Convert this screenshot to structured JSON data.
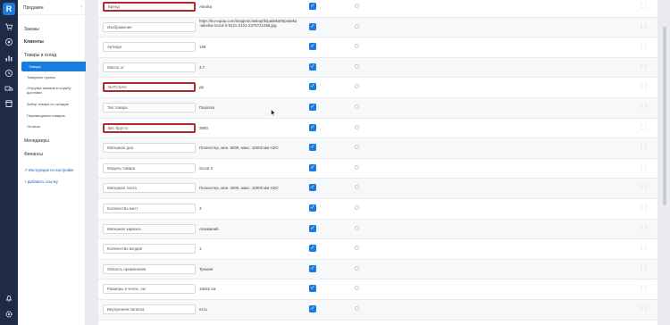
{
  "app": {
    "logo_letter": "R",
    "user_name": "Продакин"
  },
  "rail": {
    "icons": [
      "logo-icon",
      "cart-icon",
      "target-icon",
      "chart-icon",
      "clock-icon",
      "truck-icon",
      "store-icon",
      "bell-icon",
      "gear-icon"
    ]
  },
  "sidebar": {
    "orders": "Заказы",
    "clients": "Клиенты",
    "goods_section": "Товары и склад",
    "goods_items": [
      "Товары",
      "Товарные группы",
      "Отгрузка заказов в службу доставки",
      "Забор товара со складов",
      "Перемещения товаров",
      "Остатки"
    ],
    "managers": "Менеджеры",
    "finance": "Финансы",
    "setup_link": "Инструкция по настройке",
    "add_link": "Добавить ссылку"
  },
  "properties": [
    {
      "name": "Бренд",
      "value": "Alexika",
      "highlight": true
    },
    {
      "name": "Изображение",
      "value": "https://tiu-equip.com/images/catalog/tk/palatka/9/palatka-alexika-scout-3-9121-3101-2375721068.jpg",
      "highlight": false
    },
    {
      "name": "Артикул",
      "value": "159",
      "highlight": false
    },
    {
      "name": "Масса, кг",
      "value": "3.7",
      "highlight": false
    },
    {
      "name": "NoTCSAH",
      "value": "да",
      "highlight": true
    },
    {
      "name": "Тип товара",
      "value": "Палатка",
      "highlight": false
    },
    {
      "name": "Вес брутто",
      "value": "3900",
      "highlight": true
    },
    {
      "name": "Материал дна",
      "value": "Полиэстер, мин. 6000, макс. 10000 мм H2O",
      "highlight": false
    },
    {
      "name": "Модель товара",
      "value": "Scout 3",
      "highlight": false
    },
    {
      "name": "Материал тента",
      "value": "Полиэстер, мин. 4000, макс. 10000 мм H2O",
      "highlight": false
    },
    {
      "name": "Количество мест",
      "value": "3",
      "highlight": false
    },
    {
      "name": "Материал каркаса",
      "value": "Алюминий",
      "highlight": false
    },
    {
      "name": "Количество входов",
      "value": "1",
      "highlight": false
    },
    {
      "name": "Область применения",
      "value": "Трекинг",
      "highlight": false
    },
    {
      "name": "Размеры в чехле, см",
      "value": "18х52 см",
      "highlight": false
    },
    {
      "name": "Внутренняя палатка",
      "value": "есть",
      "highlight": false
    }
  ]
}
